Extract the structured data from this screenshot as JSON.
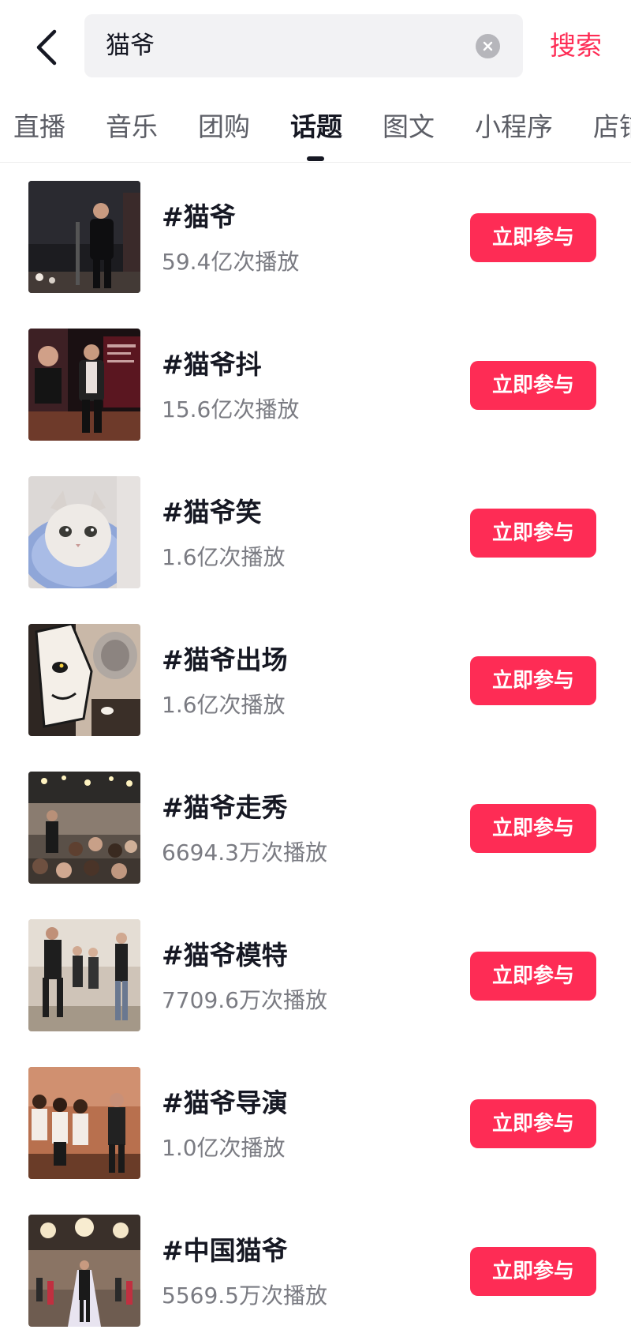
{
  "search": {
    "query": "猫爷",
    "submit_label": "搜索"
  },
  "tabs": [
    {
      "label": "直播",
      "active": false
    },
    {
      "label": "音乐",
      "active": false
    },
    {
      "label": "团购",
      "active": false
    },
    {
      "label": "话题",
      "active": true
    },
    {
      "label": "图文",
      "active": false
    },
    {
      "label": "小程序",
      "active": false
    },
    {
      "label": "店铺",
      "active": false
    }
  ],
  "join_label": "立即参与",
  "topics": [
    {
      "title": "#猫爷",
      "plays": "59.4亿次播放",
      "thumb": "man-in-black-on-stage"
    },
    {
      "title": "#猫爷抖",
      "plays": "15.6亿次播放",
      "thumb": "man-on-red-stage"
    },
    {
      "title": "#猫爷笑",
      "plays": "1.6亿次播放",
      "thumb": "white-kitten"
    },
    {
      "title": "#猫爷出场",
      "plays": "1.6亿次播放",
      "thumb": "cartoon-cat"
    },
    {
      "title": "#猫爷走秀",
      "plays": "6694.3万次播放",
      "thumb": "runway-crowd"
    },
    {
      "title": "#猫爷模特",
      "plays": "7709.6万次播放",
      "thumb": "models-walking"
    },
    {
      "title": "#猫爷导演",
      "plays": "1.0亿次播放",
      "thumb": "models-lineup"
    },
    {
      "title": "#中国猫爷",
      "plays": "5569.5万次播放",
      "thumb": "ballroom-runway"
    }
  ],
  "colors": {
    "accent": "#fe2c55",
    "text_primary": "#161823",
    "text_secondary": "#7a7b82",
    "search_bg": "#f2f2f4"
  }
}
